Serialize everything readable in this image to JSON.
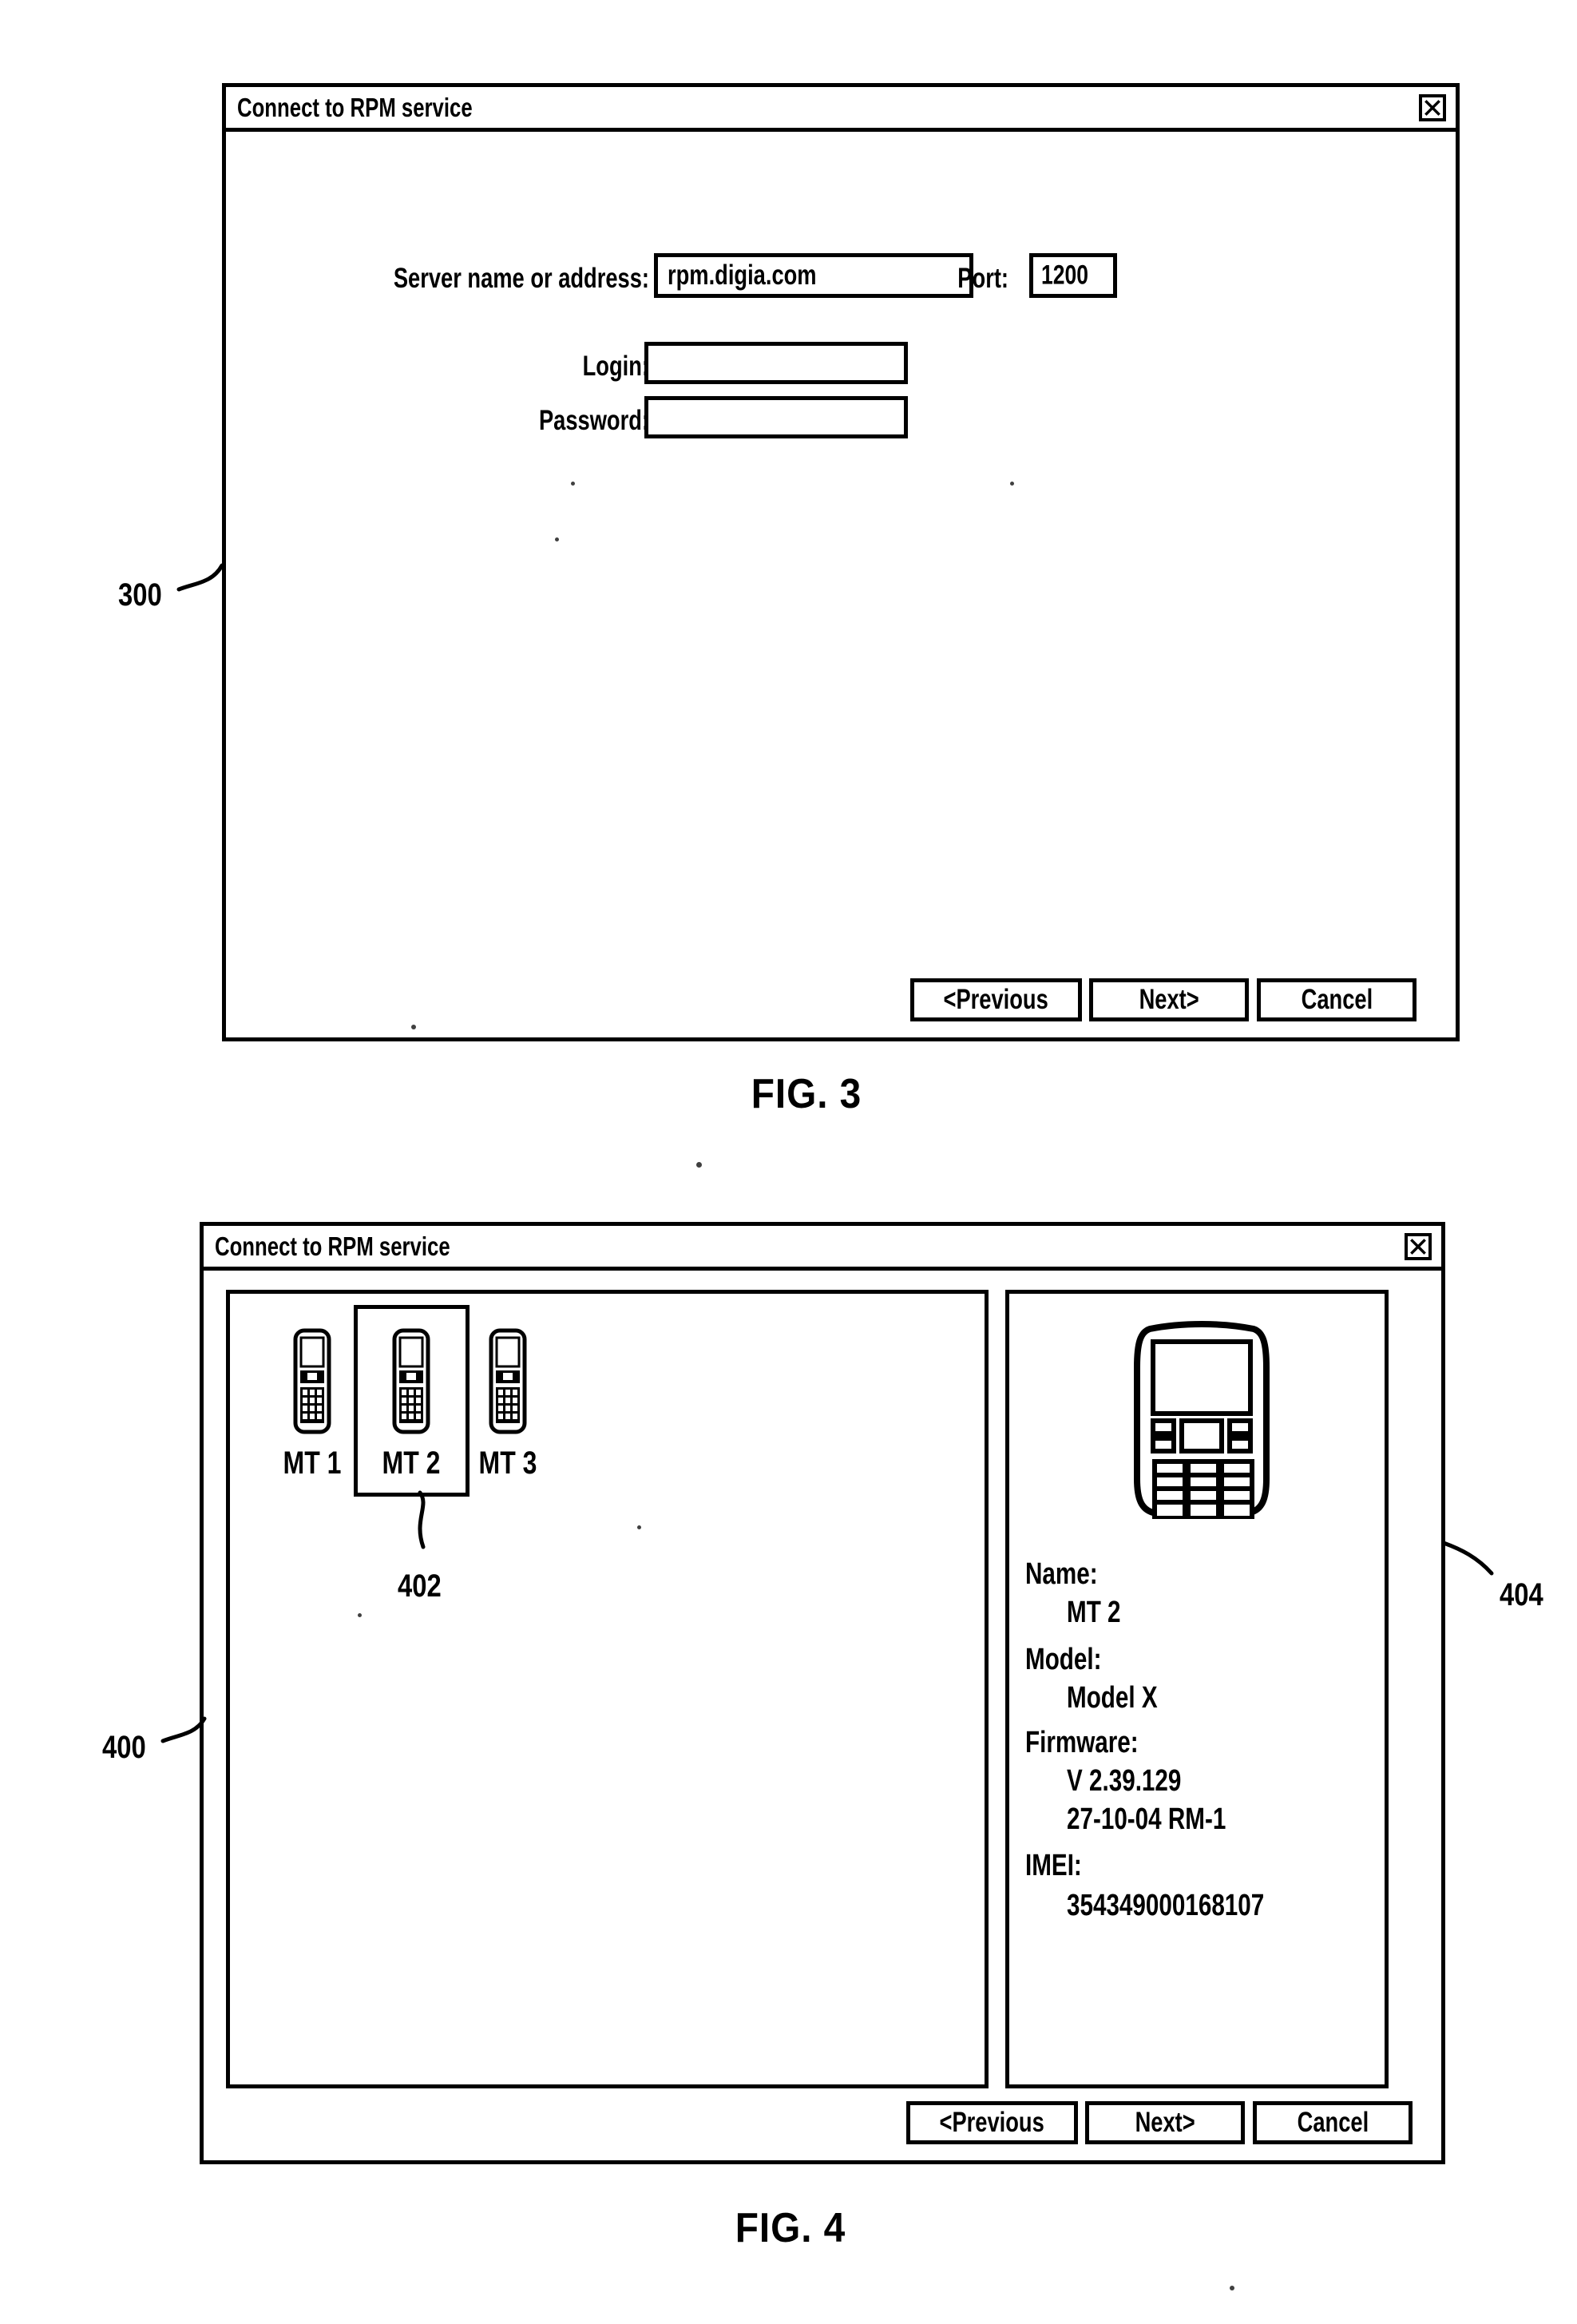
{
  "page": {
    "figures": [
      {
        "id": "fig3",
        "caption": "FIG. 3",
        "reference_numeral": "300"
      },
      {
        "id": "fig4",
        "caption": "FIG. 4",
        "reference_numeral": "400"
      }
    ]
  },
  "fig3": {
    "window": {
      "title": "Connect to RPM service",
      "close_icon": "close-x-icon"
    },
    "form": {
      "server_label": "Server name or address:",
      "server_value": "rpm.digia.com",
      "port_label": "Port:",
      "port_value": "1200",
      "login_label": "Login:",
      "login_value": "",
      "password_label": "Password:",
      "password_value": ""
    },
    "buttons": {
      "previous": "<Previous",
      "next": "Next>",
      "cancel": "Cancel"
    },
    "reference_numeral": "300",
    "caption": "FIG. 3"
  },
  "fig4": {
    "window": {
      "title": "Connect to RPM service",
      "close_icon": "close-x-icon"
    },
    "devices": [
      {
        "label": "MT 1",
        "icon": "mobile-phone-icon",
        "selected": false
      },
      {
        "label": "MT 2",
        "icon": "mobile-phone-icon",
        "selected": true
      },
      {
        "label": "MT 3",
        "icon": "mobile-phone-icon",
        "selected": false
      }
    ],
    "selection_reference_numeral": "402",
    "details_reference_numeral": "404",
    "details": {
      "preview_icon": "mobile-phone-large-icon",
      "name_label": "Name:",
      "name_value": "MT 2",
      "model_label": "Model:",
      "model_value": "Model X",
      "firmware_label": "Firmware:",
      "firmware_value_line1": "V 2.39.129",
      "firmware_value_line2": "27-10-04 RM-1",
      "imei_label": "IMEI:",
      "imei_value": "354349000168107"
    },
    "buttons": {
      "previous": "<Previous",
      "next": "Next>",
      "cancel": "Cancel"
    },
    "reference_numeral": "400",
    "caption": "FIG. 4"
  }
}
